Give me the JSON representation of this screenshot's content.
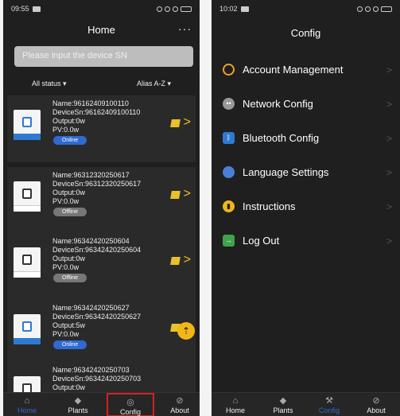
{
  "left": {
    "status_time": "09:55",
    "title": "Home",
    "more": "···",
    "search_placeholder": "Please input the device SN",
    "filter_status": "All status ▾",
    "filter_sort": "Alias A-Z ▾",
    "devices": [
      {
        "name": "Name:96162409100110",
        "sn": "DeviceSn:96162409100110",
        "output": "Output:0w",
        "pv": "PV:0.0w",
        "status": "Online"
      },
      {
        "name": "Name:96312320250617",
        "sn": "DeviceSn:96312320250617",
        "output": "Output:0w",
        "pv": "PV:0.0w",
        "status": "Offline"
      },
      {
        "name": "Name:96342420250604",
        "sn": "DeviceSn:96342420250604",
        "output": "Output:0w",
        "pv": "PV:0.0w",
        "status": "Offline"
      },
      {
        "name": "Name:96342420250627",
        "sn": "DeviceSn:96342420250627",
        "output": "Output:5w",
        "pv": "PV:0.0w",
        "status": "Online"
      },
      {
        "name": "Name:96342420250703",
        "sn": "DeviceSn:96342420250703",
        "output": "Output:0w",
        "pv": "",
        "status": ""
      }
    ],
    "tabs": [
      {
        "label": "Home",
        "icon": "home-icon"
      },
      {
        "label": "Plants",
        "icon": "plants-icon"
      },
      {
        "label": "Config",
        "icon": "globe-icon"
      },
      {
        "label": "About",
        "icon": "compass-icon"
      }
    ]
  },
  "right": {
    "status_time": "10:02",
    "title": "Config",
    "menu": [
      {
        "label": "Account Management",
        "icon": "account-icon"
      },
      {
        "label": "Network Config",
        "icon": "network-icon"
      },
      {
        "label": "Bluetooth Config",
        "icon": "bluetooth-icon"
      },
      {
        "label": "Language Settings",
        "icon": "language-icon"
      },
      {
        "label": "Instructions",
        "icon": "book-icon"
      },
      {
        "label": "Log Out",
        "icon": "logout-icon"
      }
    ],
    "tabs": [
      {
        "label": "Home",
        "icon": "home-icon"
      },
      {
        "label": "Plants",
        "icon": "plants-icon"
      },
      {
        "label": "Config",
        "icon": "wrench-icon"
      },
      {
        "label": "About",
        "icon": "compass-icon"
      }
    ]
  },
  "colors": {
    "accent": "#2e6ad1",
    "edit": "#e9c22b",
    "highlight": "#d62020",
    "background": "#1f1f1f"
  }
}
